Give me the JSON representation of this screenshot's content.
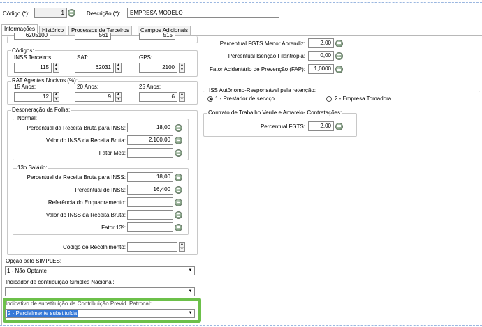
{
  "header": {
    "codigo_label": "Código (*):",
    "codigo_value": "1",
    "descricao_label": "Descrição (*):",
    "descricao_value": "EMPRESA MODELO"
  },
  "tabs": [
    {
      "label": "Informações",
      "active": true
    },
    {
      "label": "Histórico",
      "active": false
    },
    {
      "label": "Processos de Terceiros",
      "active": false
    },
    {
      "label": "Campos Adicionais",
      "active": false
    }
  ],
  "top_clipped": {
    "v1": "6205100",
    "v2": "561",
    "v3": "515"
  },
  "codigos": {
    "title": "Códigos:",
    "inss_label": "INSS Terceiros:",
    "inss_value": "115",
    "sat_label": "SAT:",
    "sat_value": "62031",
    "gps_label": "GPS:",
    "gps_value": "2100"
  },
  "rat": {
    "title": "RAT Agentes Nocivos (%):",
    "a15_label": "15 Anos:",
    "a15_value": "12",
    "a20_label": "20 Anos:",
    "a20_value": "9",
    "a25_label": "25 Anos:",
    "a25_value": "6"
  },
  "desoneracao": {
    "title": "Desoneração da Folha:",
    "normal": {
      "title": "Normal:",
      "perc_receita_label": "Percentual da Receita Bruta para INSS:",
      "perc_receita_value": "18,00",
      "valor_inss_label": "Valor do INSS da Receita Bruta:",
      "valor_inss_value": "2.100,00",
      "fator_mes_label": "Fator Mês:",
      "fator_mes_value": ""
    },
    "decimo": {
      "title": "13o Salário:",
      "perc_receita_label": "Percentual da Receita Bruta para INSS:",
      "perc_receita_value": "18,00",
      "perc_inss_label": "Percentual de INSS:",
      "perc_inss_value": "16,400",
      "ref_enq_label": "Referência do Enquadramento:",
      "ref_enq_value": "",
      "valor_inss_label": "Valor do INSS da Receita Bruta:",
      "valor_inss_value": "",
      "fator13_label": "Fator 13º:",
      "fator13_value": ""
    },
    "cod_recolhimento_label": "Código de Recolhimento:",
    "cod_recolhimento_value": ""
  },
  "simples": {
    "label": "Opção pelo SIMPLES:",
    "value": "1 - Não Optante"
  },
  "indicador": {
    "label": "Indicador de contribuição Simples Nacional:",
    "value": ""
  },
  "substituicao": {
    "label": "Indicativo de substituição da Contribuição Previd. Patronal:",
    "value": "2 - Parcialmente substituída"
  },
  "right": {
    "fgts_menor_label": "Percentual FGTS Menor Aprendiz:",
    "fgts_menor_value": "2,00",
    "isencao_label": "Percentual Isenção Filantropia:",
    "isencao_value": "0,00",
    "fap_label": "Fator Acidentário de Prevenção (FAP):",
    "fap_value": "1,0000",
    "iss_title": "ISS Autônomo-Responsável pela retenção:",
    "iss_opt1": "1 - Prestador de serviço",
    "iss_opt2": "2 - Empresa Tomadora",
    "contrato_title": "Contrato de Trabalho Verde e Amarelo- Contratações:",
    "contrato_fgts_label": "Percentual FGTS:",
    "contrato_fgts_value": "2,00"
  },
  "colors": {
    "highlight": "#6cc04a",
    "selection": "#3478d8"
  }
}
